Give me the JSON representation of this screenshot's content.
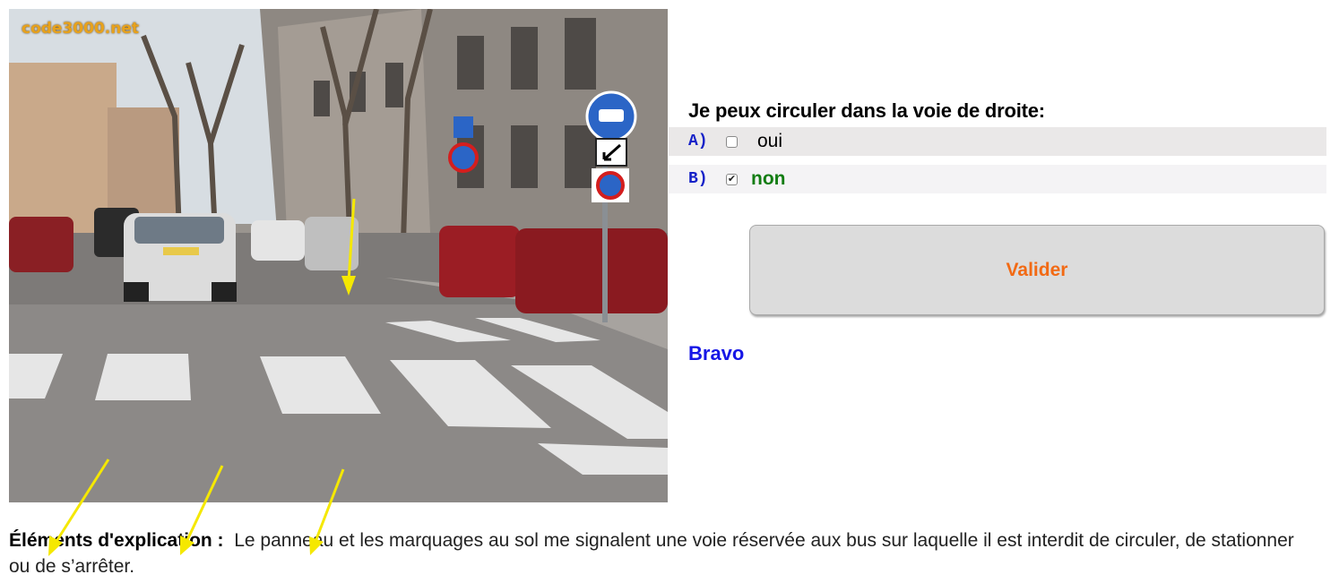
{
  "photo": {
    "watermark": "code3000.net",
    "alt": "Photo de la situation"
  },
  "question": {
    "text": "Je peux circuler dans la voie de droite:",
    "answers": [
      {
        "letter": "A)",
        "label": "oui",
        "checked": false
      },
      {
        "letter": "B)",
        "label": "non",
        "checked": true
      }
    ]
  },
  "validate": {
    "label": "Valider"
  },
  "feedback": {
    "text": "Bravo"
  },
  "explanation": {
    "label": "Éléments d'explication :",
    "text": "Le panneau et les marquages au sol me signalent une voie réservée aux bus sur laquelle il est interdit de circuler, de stationner ou de s’arrêter."
  },
  "colors": {
    "answer_letter": "#1622c8",
    "correct_answer": "#137d13",
    "validate_text": "#f26a14",
    "feedback": "#1616e6",
    "annotation_arrow": "#f5e800"
  }
}
